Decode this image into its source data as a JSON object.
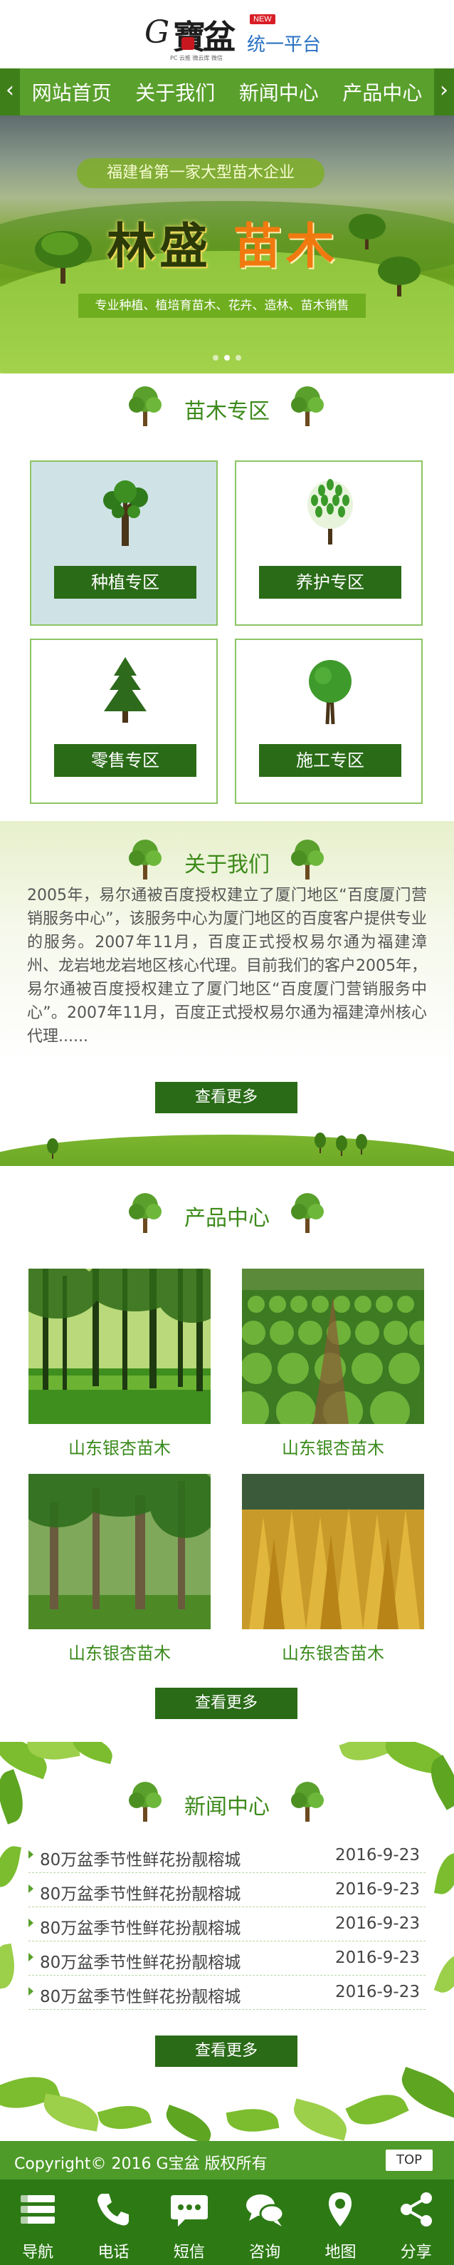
{
  "header": {
    "logo_letter": "G",
    "logo_chinese": "寶盆",
    "logo_tagline": "PC 云推  微云库  微信",
    "logo_new": "NEW",
    "logo_platform": "统一平台"
  },
  "nav": {
    "items": [
      "网站首页",
      "关于我们",
      "新闻中心",
      "产品中心"
    ]
  },
  "banner": {
    "tagline": "福建省第一家大型苗木企业",
    "title_part1": "林盛",
    "title_part2": "苗木",
    "services": "专业种植、植培育苗木、花卉、造林、苗木销售",
    "slide_count": 3,
    "active_slide": 2
  },
  "zones": {
    "title": "苗木专区",
    "items": [
      {
        "label": "种植专区",
        "icon": "deciduous-tree-icon"
      },
      {
        "label": "养护专区",
        "icon": "leafy-tree-icon"
      },
      {
        "label": "零售专区",
        "icon": "pine-tree-icon"
      },
      {
        "label": "施工专区",
        "icon": "round-tree-icon"
      }
    ]
  },
  "about": {
    "title": "关于我们",
    "text": "2005年，易尔通被百度授权建立了厦门地区“百度厦门营销服务中心”，该服务中心为厦门地区的百度客户提供专业的服务。2007年11月，百度正式授权易尔通为福建漳州、龙岩地龙岩地区核心代理。目前我们的客户2005年，易尔通被百度授权建立了厦门地区“百度厦门营销服务中心”。2007年11月，百度正式授权易尔通为福建漳州核心代理......",
    "more_label": "查看更多"
  },
  "products": {
    "title": "产品中心",
    "items": [
      {
        "name": "山东银杏苗木"
      },
      {
        "name": "山东银杏苗木"
      },
      {
        "name": "山东银杏苗木"
      },
      {
        "name": "山东银杏苗木"
      }
    ],
    "more_label": "查看更多"
  },
  "news": {
    "title": "新闻中心",
    "items": [
      {
        "title": "80万盆季节性鲜花扮靓榕城",
        "date": "2016-9-23"
      },
      {
        "title": "80万盆季节性鲜花扮靓榕城",
        "date": "2016-9-23"
      },
      {
        "title": "80万盆季节性鲜花扮靓榕城",
        "date": "2016-9-23"
      },
      {
        "title": "80万盆季节性鲜花扮靓榕城",
        "date": "2016-9-23"
      },
      {
        "title": "80万盆季节性鲜花扮靓榕城",
        "date": "2016-9-23"
      }
    ],
    "more_label": "查看更多"
  },
  "footer": {
    "copyright": "Copyright© 2016  G宝盆 版权所有",
    "top_label": "TOP",
    "tabs": [
      {
        "label": "导航",
        "icon": "menu-icon"
      },
      {
        "label": "电话",
        "icon": "phone-icon"
      },
      {
        "label": "短信",
        "icon": "sms-icon"
      },
      {
        "label": "咨询",
        "icon": "chat-icon"
      },
      {
        "label": "地图",
        "icon": "map-pin-icon"
      },
      {
        "label": "分享",
        "icon": "share-icon"
      }
    ]
  },
  "colors": {
    "brand_green": "#5aa02c",
    "dark_green": "#2a6b17",
    "title_green": "#3d8a1b",
    "platform_blue": "#2b72c2",
    "badge_red": "#d81e26"
  }
}
